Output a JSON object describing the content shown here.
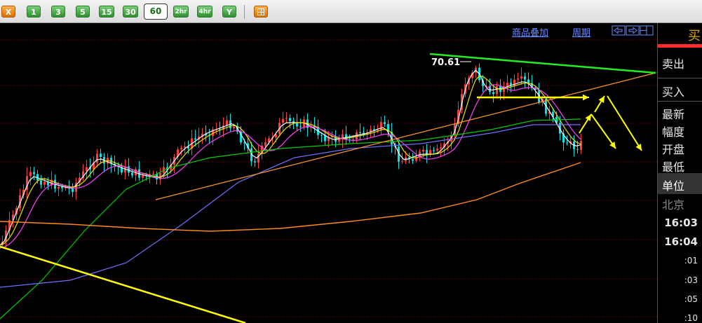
{
  "toolbar": {
    "buttons": [
      {
        "label": "X",
        "icon": "close-icon"
      },
      {
        "label": "1"
      },
      {
        "label": "3"
      },
      {
        "label": "5"
      },
      {
        "label": "15"
      },
      {
        "label": "30"
      },
      {
        "label": "60",
        "selected": true
      },
      {
        "label": "2hr"
      },
      {
        "label": "4hr"
      },
      {
        "label": "Y"
      },
      {
        "label": "",
        "icon": "grid-icon"
      }
    ]
  },
  "chart_header": {
    "overlay_link": "商品叠加",
    "period_link": "周期",
    "nav_icons": [
      "arrow-left-icon",
      "arrow-right-icon",
      "panel-toggle-icon"
    ]
  },
  "chart_data": {
    "type": "line",
    "annotations": {
      "high_label": "70.61"
    },
    "colors": {
      "candle_up": "#ff3c3c",
      "candle_down": "#00e5e5",
      "ma_white": "#ffffff",
      "ma_yellow": "#e6e600",
      "ma_magenta": "#ff40ff",
      "ma_green": "#00cc00",
      "ma_blue": "#7070ff",
      "ma_orange": "#ff8c1a",
      "trend_green": "#22ee22",
      "trend_yellow": "#ffff00",
      "gridline": "#8b0000"
    },
    "grid": true
  },
  "side_panel": {
    "header_char": "买",
    "labels": [
      "卖出",
      "买入",
      "最新",
      "幅度",
      "开盘",
      "最低",
      "单位",
      "北京"
    ],
    "times": [
      "16:03",
      "16:04",
      ":01",
      ":03",
      ":05",
      ":10"
    ]
  }
}
